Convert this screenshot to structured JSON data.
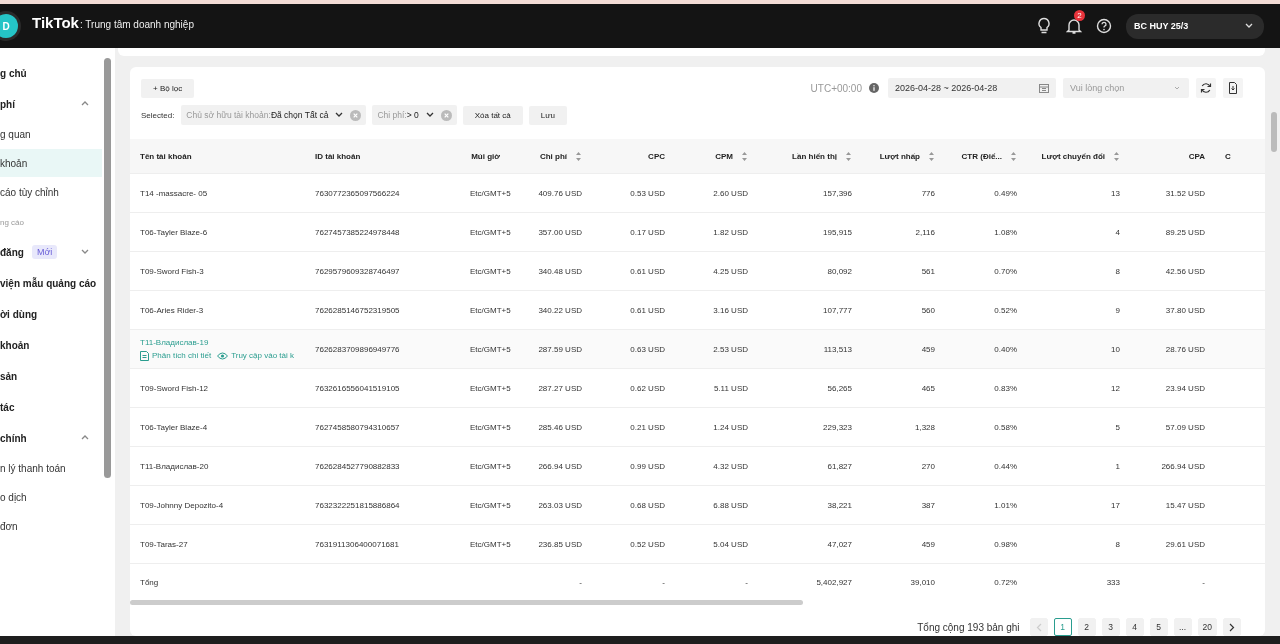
{
  "header": {
    "avatar": "D",
    "logo": "TikTok",
    "subtitle": ": Trung tâm doanh nghiệp",
    "notification_count": "2",
    "account": "BC HUY 25/3"
  },
  "sidebar": {
    "items": [
      {
        "kind": "group",
        "label": "g chủ"
      },
      {
        "kind": "group",
        "label": "phí",
        "expanded": true
      },
      {
        "kind": "item",
        "label": "g quan",
        "selected": false
      },
      {
        "kind": "item",
        "label": "khoản",
        "selected": true
      },
      {
        "kind": "item",
        "label": "cáo tùy chỉnh",
        "selected": false
      },
      {
        "kind": "section",
        "label": "ng cáo"
      },
      {
        "kind": "group",
        "label": "đăng",
        "badge": "Mới",
        "expanded": false
      },
      {
        "kind": "group",
        "label": "viện mẫu quảng cáo"
      },
      {
        "kind": "group",
        "label": "ời dùng"
      },
      {
        "kind": "group",
        "label": "khoản"
      },
      {
        "kind": "group",
        "label": "sản"
      },
      {
        "kind": "group",
        "label": "tác"
      },
      {
        "kind": "group",
        "label": "chính",
        "expanded": true
      },
      {
        "kind": "item",
        "label": "n lý thanh toán",
        "selected": false
      },
      {
        "kind": "item",
        "label": "o dịch",
        "selected": false
      },
      {
        "kind": "item",
        "label": "đơn",
        "selected": false
      }
    ]
  },
  "toolbar": {
    "filter_button": "+ Bộ lọc",
    "timezone": "UTC+00:00",
    "date_range": "2026-04-28 ~ 2026-04-28",
    "select_placeholder": "Vui lòng chọn"
  },
  "filters": {
    "label": "Selected:",
    "chips": [
      {
        "key": "Chủ sở hữu tài khoản:",
        "value": "Đã chọn Tất cả"
      },
      {
        "key": "Chi phí:",
        "value": "> 0"
      }
    ],
    "clear_all": "Xóa tất cả",
    "save": "Lưu"
  },
  "table": {
    "columns": [
      {
        "label": "Tên tài khoản",
        "sortable": false
      },
      {
        "label": "ID tài khoản",
        "sortable": false
      },
      {
        "label": "Múi giờ",
        "sortable": false
      },
      {
        "label": "Chi phí",
        "sortable": true
      },
      {
        "label": "CPC",
        "sortable": false
      },
      {
        "label": "CPM",
        "sortable": true
      },
      {
        "label": "Lần hiển thị",
        "sortable": true
      },
      {
        "label": "Lượt nhấp",
        "sortable": true
      },
      {
        "label": "CTR (Điể...",
        "sortable": true
      },
      {
        "label": "Lượt chuyển đổi",
        "sortable": true
      },
      {
        "label": "CPA",
        "sortable": false
      },
      {
        "label": "C",
        "sortable": false
      }
    ],
    "rows": [
      {
        "hovered": false,
        "cells": [
          "T14 -massacre- 05",
          "7630772365097566224",
          "Etc/GMT+5",
          "409.76 USD",
          "0.53 USD",
          "2.60 USD",
          "157,396",
          "776",
          "0.49%",
          "13",
          "31.52 USD"
        ]
      },
      {
        "hovered": false,
        "cells": [
          "T06-Tayler Blaze-6",
          "7627457385224978448",
          "Etc/GMT+5",
          "357.00 USD",
          "0.17 USD",
          "1.82 USD",
          "195,915",
          "2,116",
          "1.08%",
          "4",
          "89.25 USD"
        ]
      },
      {
        "hovered": false,
        "cells": [
          "T09-Sword Fish-3",
          "7629579609328746497",
          "Etc/GMT+5",
          "340.48 USD",
          "0.61 USD",
          "4.25 USD",
          "80,092",
          "561",
          "0.70%",
          "8",
          "42.56 USD"
        ]
      },
      {
        "hovered": false,
        "cells": [
          "T06-Aries Rider-3",
          "7626285146752319505",
          "Etc/GMT+5",
          "340.22 USD",
          "0.61 USD",
          "3.16 USD",
          "107,777",
          "560",
          "0.52%",
          "9",
          "37.80 USD"
        ]
      },
      {
        "hovered": true,
        "cells": [
          "T11-Владислав-19",
          "7626283709896949776",
          "Etc/GMT+5",
          "287.59 USD",
          "0.63 USD",
          "2.53 USD",
          "113,513",
          "459",
          "0.40%",
          "10",
          "28.76 USD"
        ],
        "actions": [
          {
            "kind": "report",
            "label": "Phân tích chi tiết"
          },
          {
            "kind": "view",
            "label": "Truy cập vào tài k"
          }
        ]
      },
      {
        "hovered": false,
        "cells": [
          "T09-Sword Fish-12",
          "7632616556041519105",
          "Etc/GMT+5",
          "287.27 USD",
          "0.62 USD",
          "5.11 USD",
          "56,265",
          "465",
          "0.83%",
          "12",
          "23.94 USD"
        ]
      },
      {
        "hovered": false,
        "cells": [
          "T06-Tayler Blaze-4",
          "7627458580794310657",
          "Etc/GMT+5",
          "285.46 USD",
          "0.21 USD",
          "1.24 USD",
          "229,323",
          "1,328",
          "0.58%",
          "5",
          "57.09 USD"
        ]
      },
      {
        "hovered": false,
        "cells": [
          "T11-Владислав-20",
          "7626284527790882833",
          "Etc/GMT+5",
          "266.94 USD",
          "0.99 USD",
          "4.32 USD",
          "61,827",
          "270",
          "0.44%",
          "1",
          "266.94 USD"
        ]
      },
      {
        "hovered": false,
        "cells": [
          "T09-Johnny Depozito-4",
          "7632322251815886864",
          "Etc/GMT+5",
          "263.03 USD",
          "0.68 USD",
          "6.88 USD",
          "38,221",
          "387",
          "1.01%",
          "17",
          "15.47 USD"
        ]
      },
      {
        "hovered": false,
        "cells": [
          "T09-Taras-27",
          "7631911306400071681",
          "Etc/GMT+5",
          "236.85 USD",
          "0.52 USD",
          "5.04 USD",
          "47,027",
          "459",
          "0.98%",
          "8",
          "29.61 USD"
        ]
      }
    ],
    "totals": {
      "label": "Tổng",
      "values": [
        "-",
        "-",
        "-",
        "5,402,927",
        "39,010",
        "0.72%",
        "333",
        "-"
      ]
    }
  },
  "pagination": {
    "total": "Tổng cộng 193 bản ghi",
    "prev_disabled": true,
    "pages": [
      {
        "label": "1",
        "selected": true
      },
      {
        "label": "2",
        "selected": false
      },
      {
        "label": "3",
        "selected": false
      },
      {
        "label": "4",
        "selected": false
      },
      {
        "label": "5",
        "selected": false
      },
      {
        "label": "...",
        "selected": false
      },
      {
        "label": "20",
        "selected": false
      }
    ]
  }
}
